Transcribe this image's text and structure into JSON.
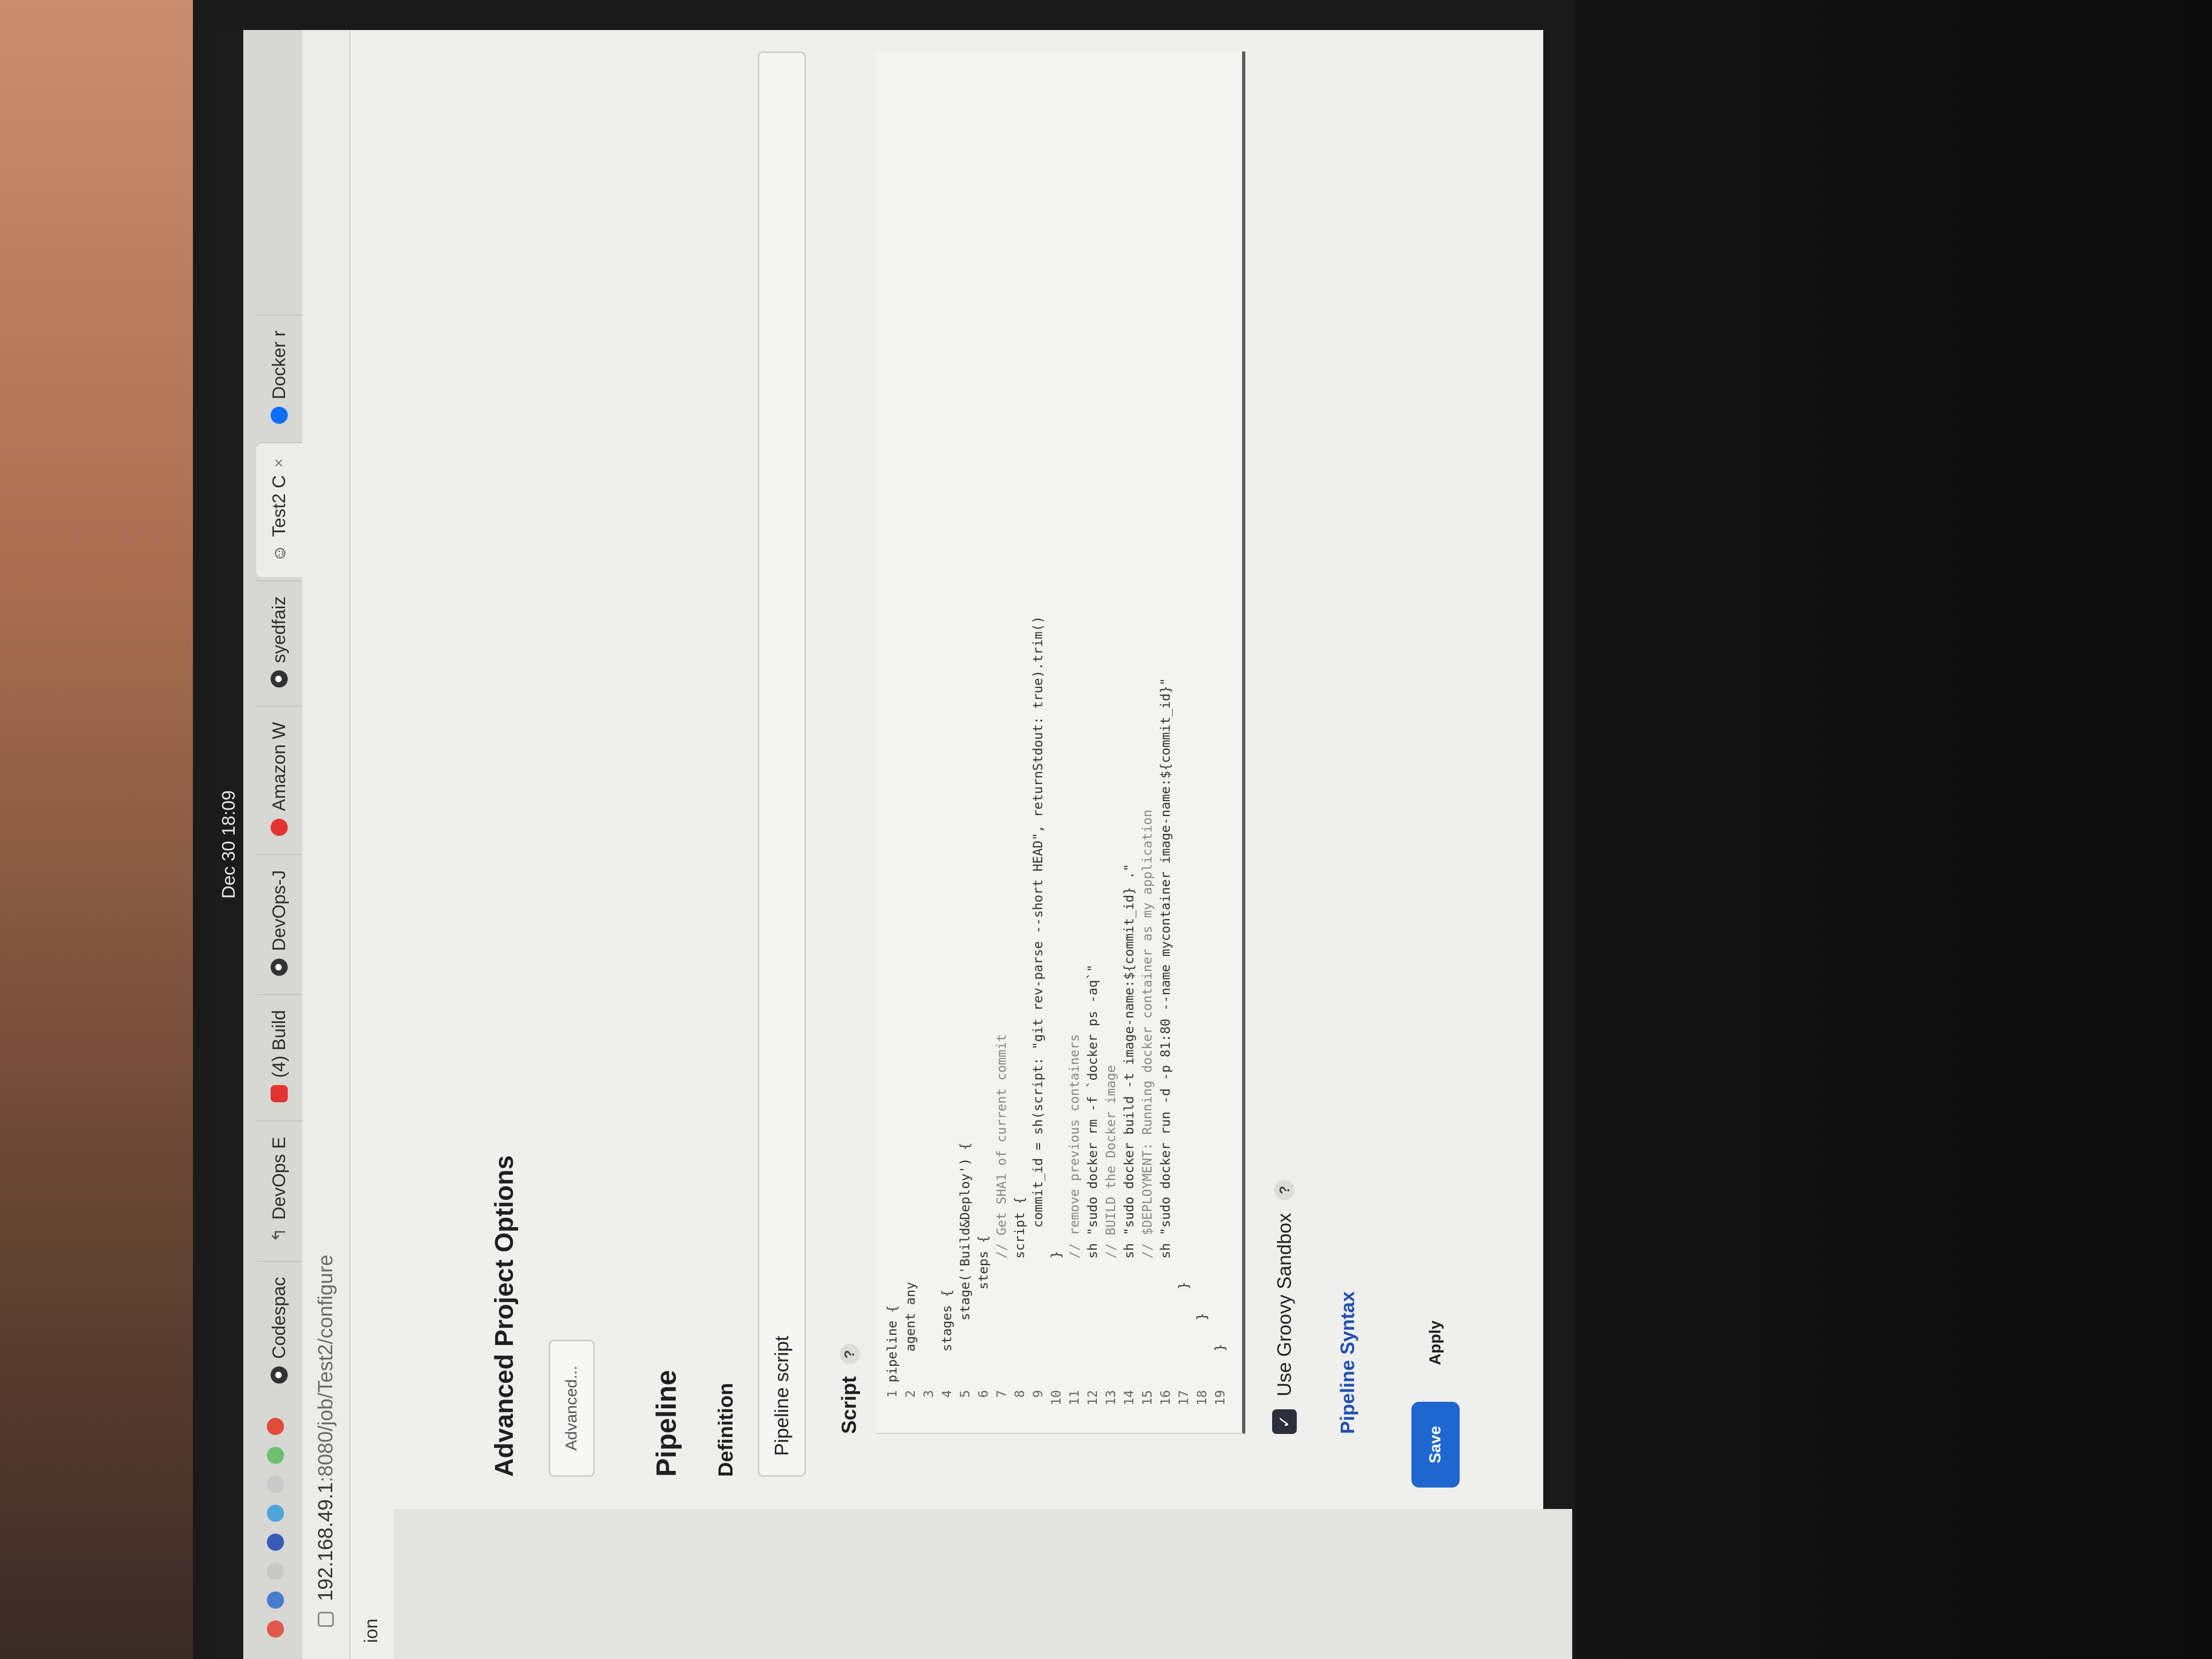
{
  "topbar": {
    "clock": "Dec 30  18:09"
  },
  "tabs": [
    {
      "label": "Codespac",
      "icon": "github-icon",
      "active": false
    },
    {
      "label": "DevOps E",
      "icon": "devops-icon",
      "active": false
    },
    {
      "label": "(4) Build",
      "icon": "youtube-icon",
      "active": false
    },
    {
      "label": "DevOps-J",
      "icon": "github-icon",
      "active": false
    },
    {
      "label": "Amazon W",
      "icon": "amazon-icon",
      "active": false
    },
    {
      "label": "syedfaiz",
      "icon": "github-icon",
      "active": false
    },
    {
      "label": "Test2 C",
      "icon": "jenkins-icon",
      "active": true
    },
    {
      "label": "Docker r",
      "icon": "docker-icon",
      "active": false
    }
  ],
  "url": {
    "host": "192.168.49.1",
    "path": ":8080/job/Test2/configure"
  },
  "crumb_fragment": "ion",
  "advanced": {
    "heading": "Advanced Project Options",
    "button_label": "Advanced..."
  },
  "pipeline": {
    "heading": "Pipeline",
    "definition_label": "Definition",
    "definition_value": "Pipeline script",
    "script_label": "Script",
    "help": "?",
    "code_lines": [
      {
        "n": "1",
        "text": "pipeline {"
      },
      {
        "n": "2",
        "text": "    agent any"
      },
      {
        "n": "3",
        "text": ""
      },
      {
        "n": "4",
        "text": "    stages {"
      },
      {
        "n": "5",
        "text": "        stage('Build&Deploy') {"
      },
      {
        "n": "6",
        "text": "            steps {"
      },
      {
        "n": "7",
        "text": "                // Get SHA1 of current commit"
      },
      {
        "n": "8",
        "text": "                script {"
      },
      {
        "n": "9",
        "text": "                    commit_id = sh(script: \"git rev-parse --short HEAD\", returnStdout: true).trim()"
      },
      {
        "n": "10",
        "text": "                }"
      },
      {
        "n": "11",
        "text": "                // remove previous containers"
      },
      {
        "n": "12",
        "text": "                sh \"sudo docker rm -f `docker ps -aq`\""
      },
      {
        "n": "13",
        "text": "                // BUILD the Docker image"
      },
      {
        "n": "14",
        "text": "                sh \"sudo docker build -t image-name:${commit_id} .\""
      },
      {
        "n": "15",
        "text": "                // $DEPLOYMENT: Running docker container as my application"
      },
      {
        "n": "16",
        "text": "                sh \"sudo docker run -d -p 81:80 --name mycontainer image-name:${commit_id}\""
      },
      {
        "n": "17",
        "text": "            }"
      },
      {
        "n": "18",
        "text": "        }"
      },
      {
        "n": "19",
        "text": "    }"
      }
    ],
    "sandbox_label": "Use Groovy Sandbox",
    "sandbox_checked": "✓",
    "syntax_link": "Pipeline Syntax"
  },
  "actions": {
    "save": "Save",
    "apply": "Apply"
  }
}
